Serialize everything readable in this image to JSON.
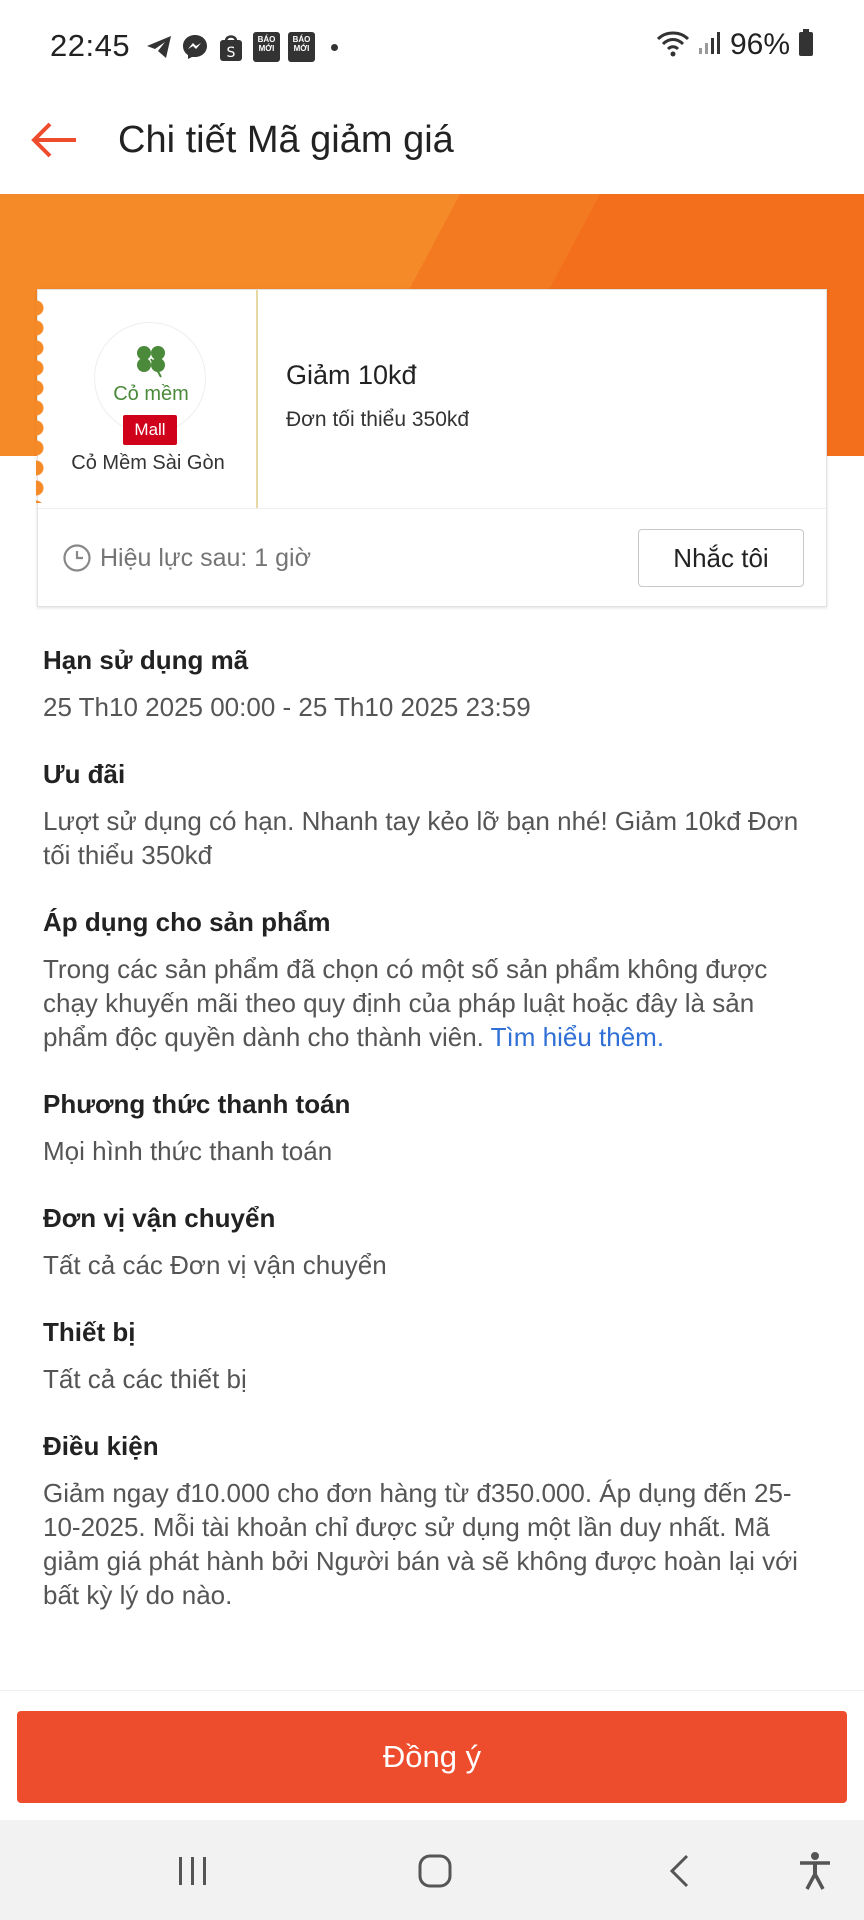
{
  "status_bar": {
    "time": "22:45",
    "notif_box_label": "BÁO MỚI",
    "battery": "96%"
  },
  "header": {
    "title": "Chi tiết Mã giảm giá"
  },
  "voucher": {
    "shop_logo_text": "Cỏ mềm",
    "mall_badge": "Mall",
    "shop_name": "Cỏ Mềm Sài Gòn",
    "title": "Giảm 10kđ",
    "min_order": "Đơn tối thiểu 350kđ",
    "validity": "Hiệu lực sau: 1 giờ",
    "remind_label": "Nhắc tôi"
  },
  "sections": [
    {
      "title": "Hạn sử dụng mã",
      "body": "25 Th10 2025 00:00 - 25 Th10 2025 23:59"
    },
    {
      "title": "Ưu đãi",
      "body": "Lượt sử dụng có hạn. Nhanh tay kẻo lỡ bạn nhé! Giảm 10kđ Đơn tối thiểu 350kđ"
    },
    {
      "title": "Áp dụng cho sản phẩm",
      "body": "Trong các sản phẩm đã chọn có một số sản phẩm không được chạy khuyến mãi theo quy định của pháp luật hoặc đây là sản phẩm độc quyền dành cho thành viên.",
      "link": "Tìm hiểu thêm."
    },
    {
      "title": "Phương thức thanh toán",
      "body": "Mọi hình thức thanh toán"
    },
    {
      "title": "Đơn vị vận chuyển",
      "body": "Tất cả các Đơn vị vận chuyển"
    },
    {
      "title": "Thiết bị",
      "body": "Tất cả các thiết bị"
    },
    {
      "title": "Điều kiện",
      "body": "Giảm ngay đ10.000 cho đơn hàng từ đ350.000. Áp dụng đến 25-10-2025. Mỗi tài khoản chỉ được sử dụng một lần duy nhất. Mã giảm giá phát hành bởi Người bán và sẽ không được hoàn lại với bất kỳ lý do nào."
    }
  ],
  "footer": {
    "agree_label": "Đồng ý"
  },
  "colors": {
    "brand": "#ee4d2d",
    "banner": "#f36f1c",
    "link": "#2f6fd6",
    "mall": "#d0011b"
  },
  "icons": [
    "back-arrow-icon",
    "clock-icon",
    "telegram-icon",
    "messenger-icon",
    "shopee-icon",
    "wifi-icon",
    "signal-icon",
    "battery-icon",
    "recent-apps-icon",
    "home-icon",
    "back-nav-icon",
    "accessibility-icon"
  ]
}
